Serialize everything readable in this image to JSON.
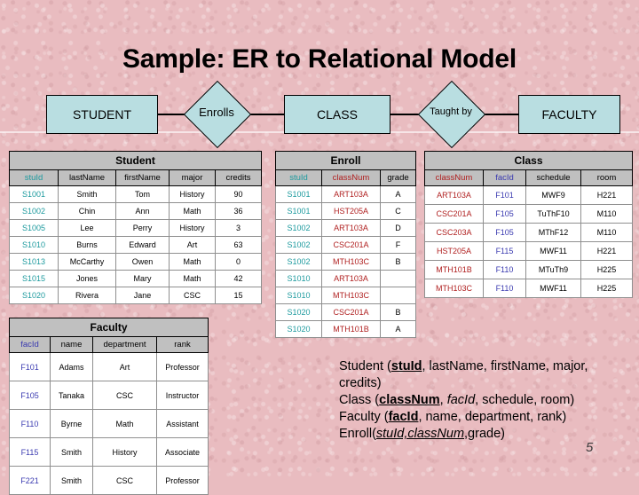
{
  "slide": {
    "title": "Sample: ER to Relational Model",
    "page_number": "5",
    "background_color": "#e9bcc0",
    "entity_fill_color": "#b9dee1",
    "header_fill_color": "#c0c0c0"
  },
  "er_diagram": {
    "entities": [
      {
        "label": "STUDENT"
      },
      {
        "label": "CLASS"
      },
      {
        "label": "FACULTY"
      }
    ],
    "relationships": [
      {
        "label": "Enrolls"
      },
      {
        "label": "Taught by"
      }
    ]
  },
  "tables": {
    "student": {
      "caption": "Student",
      "columns": [
        "stuId",
        "lastName",
        "firstName",
        "major",
        "credits"
      ],
      "column_colors": [
        "#1d9a9e",
        "#000000",
        "#000000",
        "#000000",
        "#000000"
      ],
      "rows": [
        [
          "S1001",
          "Smith",
          "Tom",
          "History",
          "90"
        ],
        [
          "S1002",
          "Chin",
          "Ann",
          "Math",
          "36"
        ],
        [
          "S1005",
          "Lee",
          "Perry",
          "History",
          "3"
        ],
        [
          "S1010",
          "Burns",
          "Edward",
          "Art",
          "63"
        ],
        [
          "S1013",
          "McCarthy",
          "Owen",
          "Math",
          "0"
        ],
        [
          "S1015",
          "Jones",
          "Mary",
          "Math",
          "42"
        ],
        [
          "S1020",
          "Rivera",
          "Jane",
          "CSC",
          "15"
        ]
      ]
    },
    "enroll": {
      "caption": "Enroll",
      "columns": [
        "stuId",
        "classNum",
        "grade"
      ],
      "column_colors": [
        "#1d9a9e",
        "#b02020",
        "#000000"
      ],
      "rows": [
        [
          "S1001",
          "ART103A",
          "A"
        ],
        [
          "S1001",
          "HST205A",
          "C"
        ],
        [
          "S1002",
          "ART103A",
          "D"
        ],
        [
          "S1002",
          "CSC201A",
          "F"
        ],
        [
          "S1002",
          "MTH103C",
          "B"
        ],
        [
          "S1010",
          "ART103A",
          ""
        ],
        [
          "S1010",
          "MTH103C",
          ""
        ],
        [
          "S1020",
          "CSC201A",
          "B"
        ],
        [
          "S1020",
          "MTH101B",
          "A"
        ]
      ]
    },
    "class": {
      "caption": "Class",
      "columns": [
        "classNum",
        "facId",
        "schedule",
        "room"
      ],
      "column_colors": [
        "#b02020",
        "#3a3ab0",
        "#000000",
        "#000000"
      ],
      "rows": [
        [
          "ART103A",
          "F101",
          "MWF9",
          "H221"
        ],
        [
          "CSC201A",
          "F105",
          "TuThF10",
          "M110"
        ],
        [
          "CSC203A",
          "F105",
          "MThF12",
          "M110"
        ],
        [
          "HST205A",
          "F115",
          "MWF11",
          "H221"
        ],
        [
          "MTH101B",
          "F110",
          "MTuTh9",
          "H225"
        ],
        [
          "MTH103C",
          "F110",
          "MWF11",
          "H225"
        ]
      ]
    },
    "faculty": {
      "caption": "Faculty",
      "columns": [
        "facId",
        "name",
        "department",
        "rank"
      ],
      "column_colors": [
        "#3a3ab0",
        "#000000",
        "#000000",
        "#000000"
      ],
      "rows": [
        [
          "F101",
          "Adams",
          "Art",
          "Professor"
        ],
        [
          "F105",
          "Tanaka",
          "CSC",
          "Instructor"
        ],
        [
          "F110",
          "Byrne",
          "Math",
          "Assistant"
        ],
        [
          "F115",
          "Smith",
          "History",
          "Associate"
        ],
        [
          "F221",
          "Smith",
          "CSC",
          "Professor"
        ]
      ]
    }
  },
  "schema_text": {
    "lines": [
      {
        "relation": "Student ",
        "parts": [
          {
            "text": "stuId",
            "style": "pk"
          },
          {
            "text": ", lastName, firstName, major, credits)",
            "style": "plain"
          }
        ]
      },
      {
        "relation": "Class ",
        "parts": [
          {
            "text": "classNum",
            "style": "pk"
          },
          {
            "text": ", ",
            "style": "plain"
          },
          {
            "text": "facId",
            "style": "fk"
          },
          {
            "text": ", schedule, room)",
            "style": "plain"
          }
        ]
      },
      {
        "relation": "Faculty ",
        "parts": [
          {
            "text": "facId",
            "style": "pk"
          },
          {
            "text": ", name, department, rank)",
            "style": "plain"
          }
        ]
      },
      {
        "relation": "Enroll",
        "parts": [
          {
            "text": "stuId,classNum",
            "style": "pkfk"
          },
          {
            "text": ",grade)",
            "style": "plain"
          }
        ]
      }
    ],
    "line1": "Student (stuId, lastName, firstName, major, credits)",
    "line2": "Class (classNum, facId, schedule, room)",
    "line3": "Faculty (facId, name, department, rank)",
    "line4": "Enroll(stuId,classNum,grade)"
  }
}
